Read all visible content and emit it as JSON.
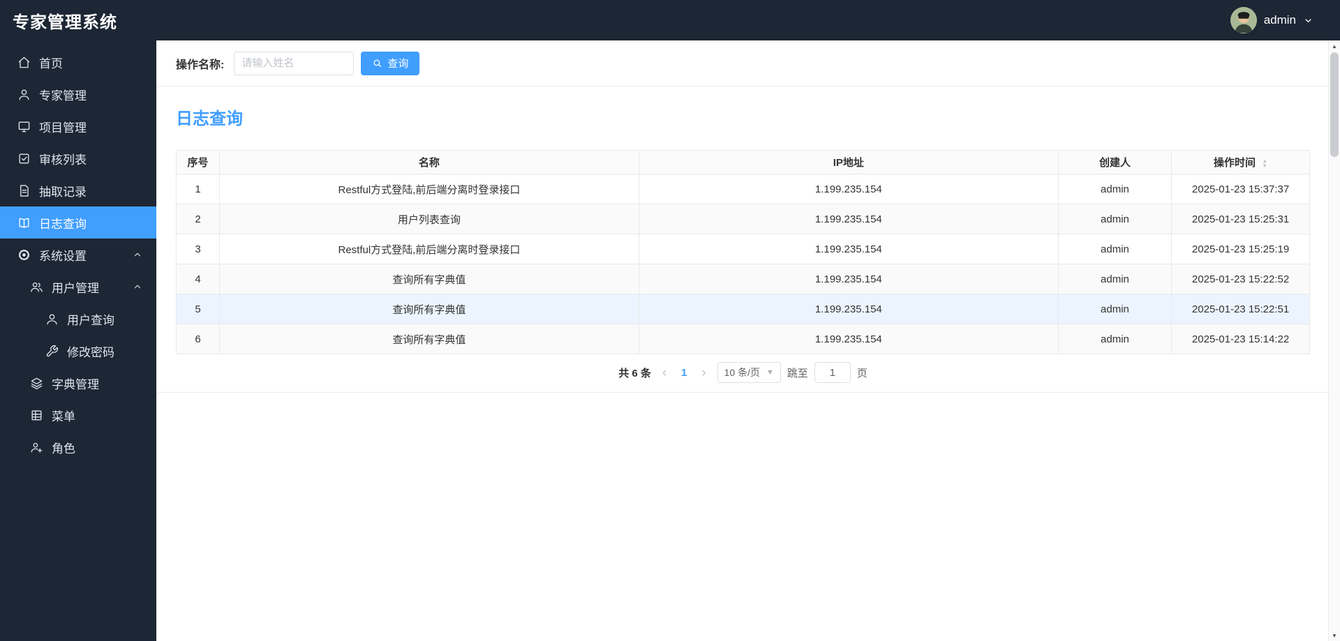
{
  "app": {
    "title": "专家管理系统"
  },
  "header": {
    "user": "admin"
  },
  "colors": {
    "accent": "#409eff",
    "dark": "#1c2634",
    "row_hover": "#ecf5ff",
    "stripe": "#fafafa"
  },
  "sidebar": {
    "items": [
      {
        "label": "首页",
        "icon": "home-icon"
      },
      {
        "label": "专家管理",
        "icon": "user-icon"
      },
      {
        "label": "项目管理",
        "icon": "monitor-icon"
      },
      {
        "label": "审核列表",
        "icon": "check-square-icon"
      },
      {
        "label": "抽取记录",
        "icon": "document-icon"
      },
      {
        "label": "日志查询",
        "icon": "book-icon",
        "active": true
      },
      {
        "label": "系统设置",
        "icon": "gear-icon",
        "expanded": true
      },
      {
        "label": "用户管理",
        "icon": "users-icon",
        "expanded": true
      },
      {
        "label": "用户查询",
        "icon": "user-icon"
      },
      {
        "label": "修改密码",
        "icon": "wrench-icon"
      },
      {
        "label": "字典管理",
        "icon": "layers-icon"
      },
      {
        "label": "菜单",
        "icon": "table-icon"
      },
      {
        "label": "角色",
        "icon": "user-plus-icon"
      }
    ]
  },
  "search": {
    "label": "操作名称:",
    "placeholder": "请输入姓名",
    "button": "查询"
  },
  "section": {
    "title": "日志查询"
  },
  "table": {
    "headers": [
      "序号",
      "名称",
      "IP地址",
      "创建人",
      "操作时间"
    ],
    "rows": [
      {
        "no": "1",
        "name": "Restful方式登陆,前后端分离时登录接口",
        "ip": "1.199.235.154",
        "creator": "admin",
        "time": "2025-01-23 15:37:37"
      },
      {
        "no": "2",
        "name": "用户列表查询",
        "ip": "1.199.235.154",
        "creator": "admin",
        "time": "2025-01-23 15:25:31"
      },
      {
        "no": "3",
        "name": "Restful方式登陆,前后端分离时登录接口",
        "ip": "1.199.235.154",
        "creator": "admin",
        "time": "2025-01-23 15:25:19"
      },
      {
        "no": "4",
        "name": "查询所有字典值",
        "ip": "1.199.235.154",
        "creator": "admin",
        "time": "2025-01-23 15:22:52"
      },
      {
        "no": "5",
        "name": "查询所有字典值",
        "ip": "1.199.235.154",
        "creator": "admin",
        "time": "2025-01-23 15:22:51"
      },
      {
        "no": "6",
        "name": "查询所有字典值",
        "ip": "1.199.235.154",
        "creator": "admin",
        "time": "2025-01-23 15:14:22"
      }
    ]
  },
  "pagination": {
    "total": "共 6 条",
    "page": "1",
    "page_size": "10 条/页",
    "jump_label": "跳至",
    "jump_value": "1",
    "jump_unit": "页"
  },
  "icons": {
    "prev": "‹",
    "next": "›",
    "sort_asc": "▲",
    "sort_desc": "▼",
    "select_caret": "▼",
    "scroll_up": "▲",
    "scroll_down": "▼"
  }
}
